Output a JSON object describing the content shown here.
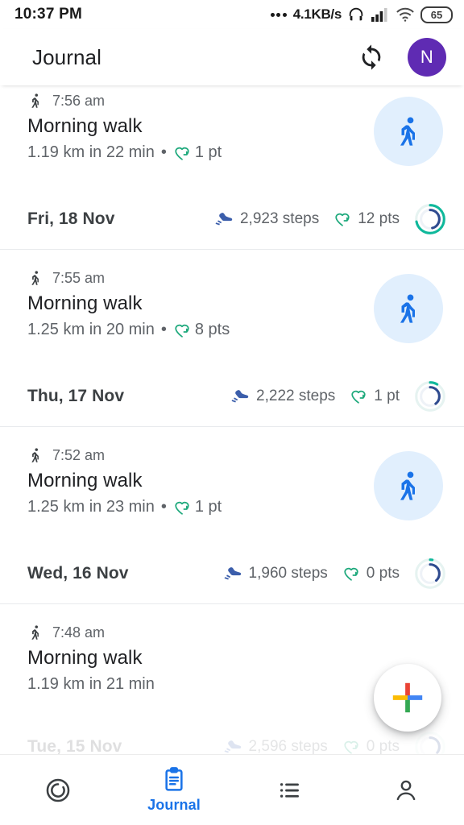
{
  "status_bar": {
    "time": "10:37 PM",
    "network_speed": "4.1KB/s",
    "battery_level": "65",
    "icons": [
      "more-dots-icon",
      "headphones-icon",
      "signal-bars-icon",
      "wifi-icon",
      "battery-icon"
    ]
  },
  "app_bar": {
    "title": "Journal",
    "sync_icon": "sync-icon",
    "avatar_initial": "N"
  },
  "colors": {
    "accent_blue": "#1a73e8",
    "points_green": "#1ea97c",
    "steps_blue": "#3b5eab",
    "ring_blue": "#2f4b8f",
    "ring_teal": "#0fb89b",
    "ring_track": "#e6f3f1",
    "avatar_purple": "#5f2bb3",
    "activity_badge_bg": "#e1effd"
  },
  "entries": [
    {
      "type": "activity",
      "icon": "walking-icon",
      "time": "7:56 am",
      "title": "Morning walk",
      "distance_duration": "1.19 km in 22 min",
      "separator": "•",
      "points": "1 pt",
      "points_icon": "heart-points-icon",
      "badge_icon": "walking-person-icon"
    },
    {
      "type": "day_summary",
      "date": "Fri, 18 Nov",
      "steps": "2,923 steps",
      "steps_icon": "shoe-steps-icon",
      "points": "12 pts",
      "points_icon": "heart-points-icon",
      "ring": {
        "icon": "progress-ring",
        "outer_pct": 72,
        "inner_pct": 46
      }
    },
    {
      "type": "activity",
      "icon": "walking-icon",
      "time": "7:55 am",
      "title": "Morning walk",
      "distance_duration": "1.25 km in 20 min",
      "separator": "•",
      "points": "8 pts",
      "points_icon": "heart-points-icon",
      "badge_icon": "walking-person-icon"
    },
    {
      "type": "day_summary",
      "date": "Thu, 17 Nov",
      "steps": "2,222 steps",
      "steps_icon": "shoe-steps-icon",
      "points": "1 pt",
      "points_icon": "heart-points-icon",
      "ring": {
        "icon": "progress-ring",
        "outer_pct": 8,
        "inner_pct": 40
      }
    },
    {
      "type": "activity",
      "icon": "walking-icon",
      "time": "7:52 am",
      "title": "Morning walk",
      "distance_duration": "1.25 km in 23 min",
      "separator": "•",
      "points": "1 pt",
      "points_icon": "heart-points-icon",
      "badge_icon": "walking-person-icon"
    },
    {
      "type": "day_summary",
      "date": "Wed, 16 Nov",
      "steps": "1,960 steps",
      "steps_icon": "shoe-steps-icon",
      "points": "0 pts",
      "points_icon": "heart-points-icon",
      "ring": {
        "icon": "progress-ring",
        "outer_pct": 3,
        "inner_pct": 38
      }
    },
    {
      "type": "activity",
      "icon": "walking-icon",
      "time": "7:48 am",
      "title": "Morning walk",
      "distance_duration": "1.19 km in 21 min",
      "separator": "",
      "points": "",
      "points_icon": "heart-points-icon",
      "badge_icon": ""
    },
    {
      "type": "day_summary_partial",
      "date": "Tue, 15 Nov",
      "steps": "2,596 steps",
      "steps_icon": "shoe-steps-icon",
      "points": "0 pts",
      "points_icon": "heart-points-icon",
      "ring": {
        "icon": "progress-ring",
        "outer_pct": 3,
        "inner_pct": 35
      }
    }
  ],
  "fab": {
    "icon": "google-plus-add-icon",
    "label": "Add"
  },
  "bottom_nav": [
    {
      "icon": "home-rings-icon",
      "label": "",
      "active": false
    },
    {
      "icon": "clipboard-journal-icon",
      "label": "Journal",
      "active": true
    },
    {
      "icon": "list-icon",
      "label": "",
      "active": false
    },
    {
      "icon": "person-profile-icon",
      "label": "",
      "active": false
    }
  ]
}
